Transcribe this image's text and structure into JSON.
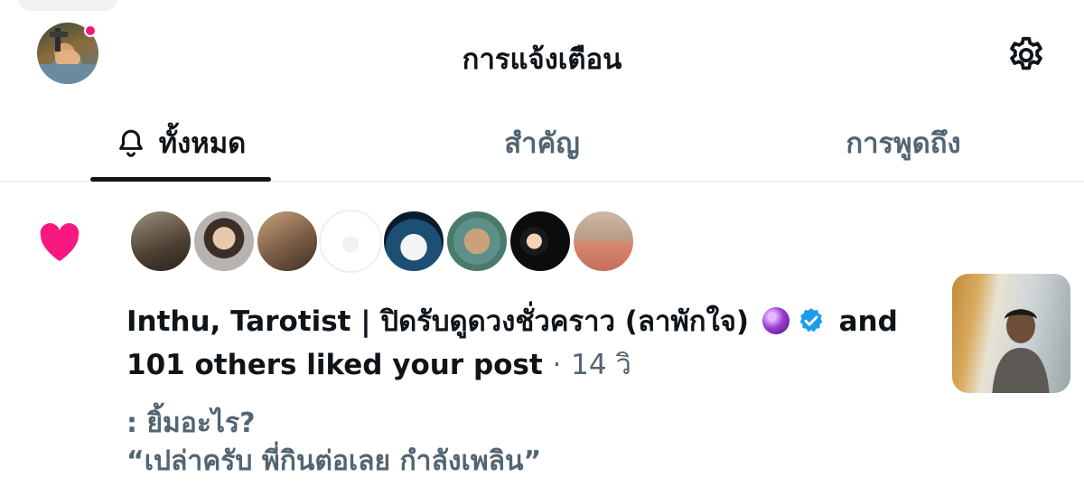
{
  "header": {
    "title": "การแจ้งเตือน"
  },
  "tabs": [
    {
      "label": "ทั้งหมด",
      "active": true
    },
    {
      "label": "สำคัญ",
      "active": false
    },
    {
      "label": "การพูดถึง",
      "active": false
    }
  ],
  "notification": {
    "type": "like",
    "actor_name": "Inthu, Tarotist | ปิดรับดูดวงชั่วคราว (ลาพักใจ)",
    "actor_suffix": "and",
    "action_text": "101 others liked your post",
    "separator": "·",
    "time": "14 วิ",
    "quote_line1": ": ยิ้มอะไร?",
    "quote_line2": "“เปล่าครับ พี่กินต่อเลย กำลังเพลิน”",
    "liker_avatar_count": 8
  },
  "colors": {
    "heart": "#f91880",
    "verified": "#1d9bf0",
    "muted_text": "#536471",
    "primary_text": "#0f1419",
    "notification_dot": "#f91880"
  },
  "icons": {
    "settings": "gear-icon",
    "bell": "bell-icon",
    "like": "heart-icon",
    "verified": "verified-badge-icon",
    "emoji": "crystal-ball-emoji"
  }
}
